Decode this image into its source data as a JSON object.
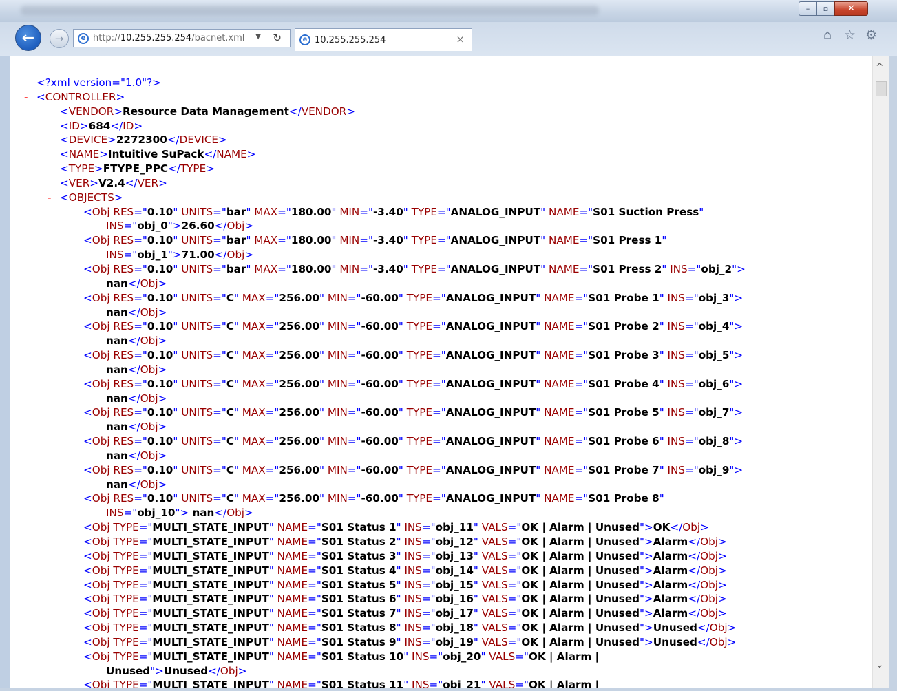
{
  "browser": {
    "address_prefix": "http://",
    "address_host": "10.255.255.254",
    "address_path": "/bacnet.xml",
    "tab_title": "10.255.255.254",
    "tab_close": "×",
    "window_buttons": {
      "minimize": "–",
      "maximize": "▫",
      "close": "✕"
    },
    "icons": [
      "back-arrow-icon",
      "forward-arrow-icon",
      "ie-logo-icon",
      "dropdown-icon",
      "refresh-icon",
      "close-icon",
      "home-icon",
      "favorites-star-icon",
      "settings-gear-icon"
    ]
  },
  "xml": {
    "declaration": "<?xml version=\"1.0\"?>",
    "collapse_symbol": "-",
    "controller_tag": "CONTROLLER",
    "vendor": "Resource Data Management",
    "id": "684",
    "device": "2272300",
    "name": "Intuitive SuPack",
    "type": "FTYPE_PPC",
    "ver": "V2.4",
    "objects_tag": "OBJECTS",
    "analog_objects": [
      {
        "res": "0.10",
        "units": "bar",
        "max": "180.00",
        "min": "-3.40",
        "type": "ANALOG_INPUT",
        "name": "S01 Suction Press",
        "ins": "obj_0",
        "value": "26.60"
      },
      {
        "res": "0.10",
        "units": "bar",
        "max": "180.00",
        "min": "-3.40",
        "type": "ANALOG_INPUT",
        "name": "S01 Press 1",
        "ins": "obj_1",
        "value": "71.00"
      },
      {
        "res": "0.10",
        "units": "bar",
        "max": "180.00",
        "min": "-3.40",
        "type": "ANALOG_INPUT",
        "name": "S01 Press 2",
        "ins": "obj_2",
        "value": "nan"
      },
      {
        "res": "0.10",
        "units": "C",
        "max": "256.00",
        "min": "-60.00",
        "type": "ANALOG_INPUT",
        "name": "S01 Probe 1",
        "ins": "obj_3",
        "value": "nan"
      },
      {
        "res": "0.10",
        "units": "C",
        "max": "256.00",
        "min": "-60.00",
        "type": "ANALOG_INPUT",
        "name": "S01 Probe 2",
        "ins": "obj_4",
        "value": "nan"
      },
      {
        "res": "0.10",
        "units": "C",
        "max": "256.00",
        "min": "-60.00",
        "type": "ANALOG_INPUT",
        "name": "S01 Probe 3",
        "ins": "obj_5",
        "value": "nan"
      },
      {
        "res": "0.10",
        "units": "C",
        "max": "256.00",
        "min": "-60.00",
        "type": "ANALOG_INPUT",
        "name": "S01 Probe 4",
        "ins": "obj_6",
        "value": "nan"
      },
      {
        "res": "0.10",
        "units": "C",
        "max": "256.00",
        "min": "-60.00",
        "type": "ANALOG_INPUT",
        "name": "S01 Probe 5",
        "ins": "obj_7",
        "value": "nan"
      },
      {
        "res": "0.10",
        "units": "C",
        "max": "256.00",
        "min": "-60.00",
        "type": "ANALOG_INPUT",
        "name": "S01 Probe 6",
        "ins": "obj_8",
        "value": "nan"
      },
      {
        "res": "0.10",
        "units": "C",
        "max": "256.00",
        "min": "-60.00",
        "type": "ANALOG_INPUT",
        "name": "S01 Probe 7",
        "ins": "obj_9",
        "value": "nan"
      },
      {
        "res": "0.10",
        "units": "C",
        "max": "256.00",
        "min": "-60.00",
        "type": "ANALOG_INPUT",
        "name": "S01 Probe 8",
        "ins": "obj_10",
        "value": "nan"
      }
    ],
    "multi_objects": [
      {
        "type": "MULTI_STATE_INPUT",
        "name": "S01 Status 1",
        "ins": "obj_11",
        "vals": "OK | Alarm | Unused",
        "value": "OK"
      },
      {
        "type": "MULTI_STATE_INPUT",
        "name": "S01 Status 2",
        "ins": "obj_12",
        "vals": "OK | Alarm | Unused",
        "value": "Alarm"
      },
      {
        "type": "MULTI_STATE_INPUT",
        "name": "S01 Status 3",
        "ins": "obj_13",
        "vals": "OK | Alarm | Unused",
        "value": "Alarm"
      },
      {
        "type": "MULTI_STATE_INPUT",
        "name": "S01 Status 4",
        "ins": "obj_14",
        "vals": "OK | Alarm | Unused",
        "value": "Alarm"
      },
      {
        "type": "MULTI_STATE_INPUT",
        "name": "S01 Status 5",
        "ins": "obj_15",
        "vals": "OK | Alarm | Unused",
        "value": "Alarm"
      },
      {
        "type": "MULTI_STATE_INPUT",
        "name": "S01 Status 6",
        "ins": "obj_16",
        "vals": "OK | Alarm | Unused",
        "value": "Alarm"
      },
      {
        "type": "MULTI_STATE_INPUT",
        "name": "S01 Status 7",
        "ins": "obj_17",
        "vals": "OK | Alarm | Unused",
        "value": "Alarm"
      },
      {
        "type": "MULTI_STATE_INPUT",
        "name": "S01 Status 8",
        "ins": "obj_18",
        "vals": "OK | Alarm | Unused",
        "value": "Unused"
      },
      {
        "type": "MULTI_STATE_INPUT",
        "name": "S01 Status 9",
        "ins": "obj_19",
        "vals": "OK | Alarm | Unused",
        "value": "Unused"
      },
      {
        "type": "MULTI_STATE_INPUT",
        "name": "S01 Status 10",
        "ins": "obj_20",
        "vals": "OK | Alarm | Unused",
        "value": "Unused"
      },
      {
        "type": "MULTI_STATE_INPUT",
        "name": "S01 Status 11",
        "ins": "obj_21",
        "vals": "OK | Alarm |",
        "value": ""
      }
    ]
  }
}
